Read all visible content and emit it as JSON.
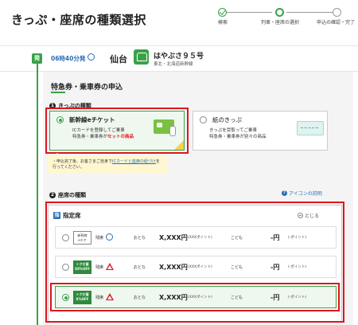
{
  "header": {
    "title": "きっぷ・座席の種類選択",
    "steps": [
      {
        "label": "検索",
        "state": "done"
      },
      {
        "label": "列車・座席の選択",
        "state": "current"
      },
      {
        "label": "申込の確認・完了",
        "state": "todo"
      }
    ]
  },
  "train": {
    "dep_badge": "発",
    "dep_time": "06時40分発",
    "station": "仙台",
    "name": "はやぶさ９５号",
    "line": "東北・北海道新幹線"
  },
  "section": {
    "title": "特急券・乗車券の申込",
    "ticket_type": {
      "number": "1",
      "heading": "きっぷの種類",
      "options": [
        {
          "title": "新幹線eチケット",
          "desc_line1": "ICカードを登録してご乗車",
          "desc_line2_prefix": "特急券・乗車券が",
          "desc_line2_red": "セットの商品",
          "selected": true
        },
        {
          "title": "紙のきっぷ",
          "desc_line1": "きっぷを受取ってご乗車",
          "desc_line2": "特急券・乗車券が別々の商品",
          "selected": false
        }
      ],
      "notice_prefix": "・申込完了後、お客さまご自身で",
      "notice_link": "ICカードと座席の紐づけ",
      "notice_suffix": "を行ってください。"
    },
    "seat_type": {
      "number": "2",
      "heading": "座席の種類",
      "help_link": "アイコンの説明",
      "help_icon": "?",
      "panel_icon": "指",
      "panel_title": "指定席",
      "collapse_label": "とじる",
      "rows": [
        {
          "badge_line1": "新幹線",
          "badge_line2": "eチケ",
          "badge_style": "plain",
          "avail_label": "残席",
          "avail_icon": "circle",
          "adult_label": "おとな",
          "adult_price": "X,XXX円",
          "adult_points": "(XXXポイント)",
          "child_label": "こども",
          "child_price": "-円",
          "child_points": "(-ポイント)",
          "selected": false
        },
        {
          "badge_line1": "トクだ値",
          "badge_line2": "XX%OFF",
          "badge_style": "green",
          "avail_label": "残席",
          "avail_icon": "triangle",
          "adult_label": "おとな",
          "adult_price": "X,XXX円",
          "adult_points": "(XXXポイント)",
          "child_label": "こども",
          "child_price": "-円",
          "child_points": "(-ポイント)",
          "selected": false
        },
        {
          "badge_line1": "トクだ値",
          "badge_line2": "X%OFF",
          "badge_style": "green",
          "avail_label": "残席",
          "avail_icon": "triangle",
          "adult_label": "おとな",
          "adult_price": "X,XXX円",
          "adult_points": "(XXXポイント)",
          "child_label": "こども",
          "child_price": "-円",
          "child_points": "(-ポイント)",
          "selected": true
        }
      ]
    }
  },
  "colors": {
    "accent": "#3aa14a",
    "highlight": "#e0141e",
    "link": "#2a6fb8",
    "notice_bg": "#fff7d1"
  }
}
